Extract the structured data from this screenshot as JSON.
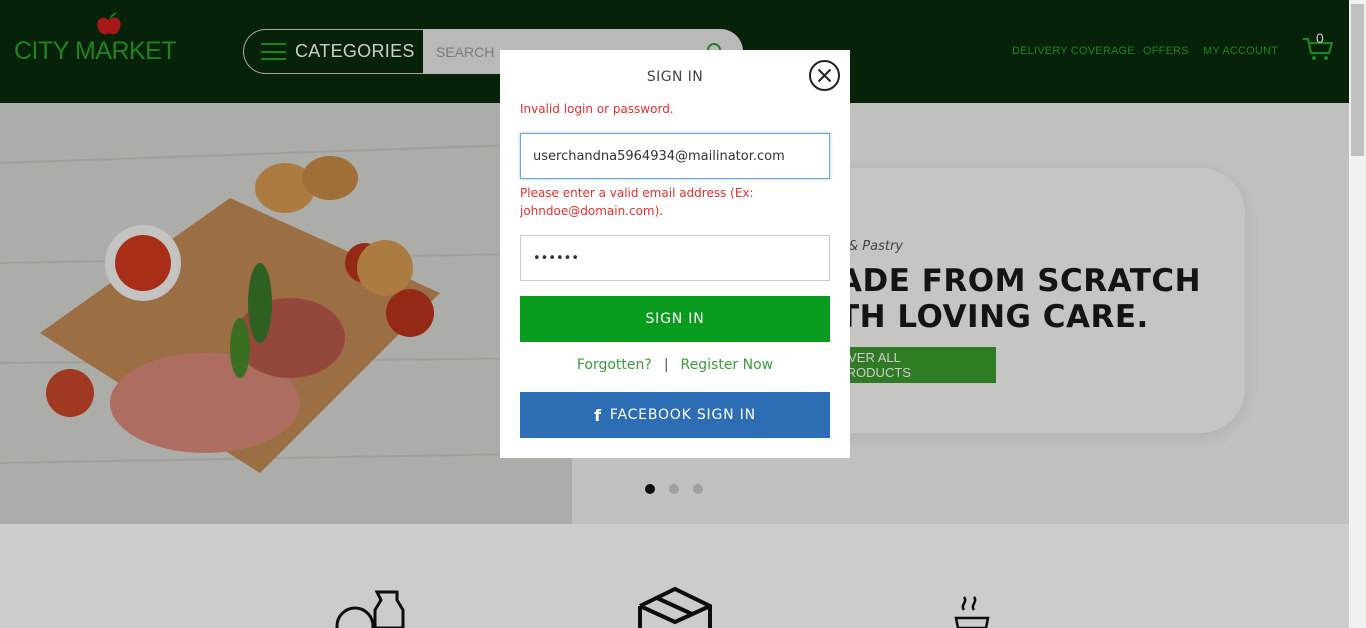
{
  "header": {
    "logo_text": "CITY MARKET",
    "categories_label": "CATEGORIES",
    "search_placeholder": "SEARCH",
    "nav": {
      "delivery": "DELIVERY COVERAGE",
      "offers": "OFFERS",
      "account": "MY ACCOUNT"
    },
    "cart_count": "0"
  },
  "hero": {
    "subtitle": "& Pastry",
    "title_line1": "ADE FROM SCRATCH",
    "title_line2": "TH LOVING CARE.",
    "button_label": "OVER ALL PRODUCTS",
    "slides": 3,
    "active_slide": 1
  },
  "modal": {
    "title": "SIGN IN",
    "error_login": "Invalid login or password.",
    "email_value": "userchandna5964934@mailinator.com",
    "email_error": "Please enter a valid email address (Ex: johndoe@domain.com).",
    "password_value": "••••••",
    "signin_button": "SIGN IN",
    "forgotten_link": "Forgotten?",
    "separator": "|",
    "register_link": "Register Now",
    "facebook_button": "FACEBOOK SIGN IN",
    "facebook_glyph": "f"
  },
  "colors": {
    "header_bg": "#082b0a",
    "brand_green": "#2aa32a",
    "signin_green": "#089b1d",
    "facebook_blue": "#2c6db3",
    "error_red": "#e03030"
  }
}
